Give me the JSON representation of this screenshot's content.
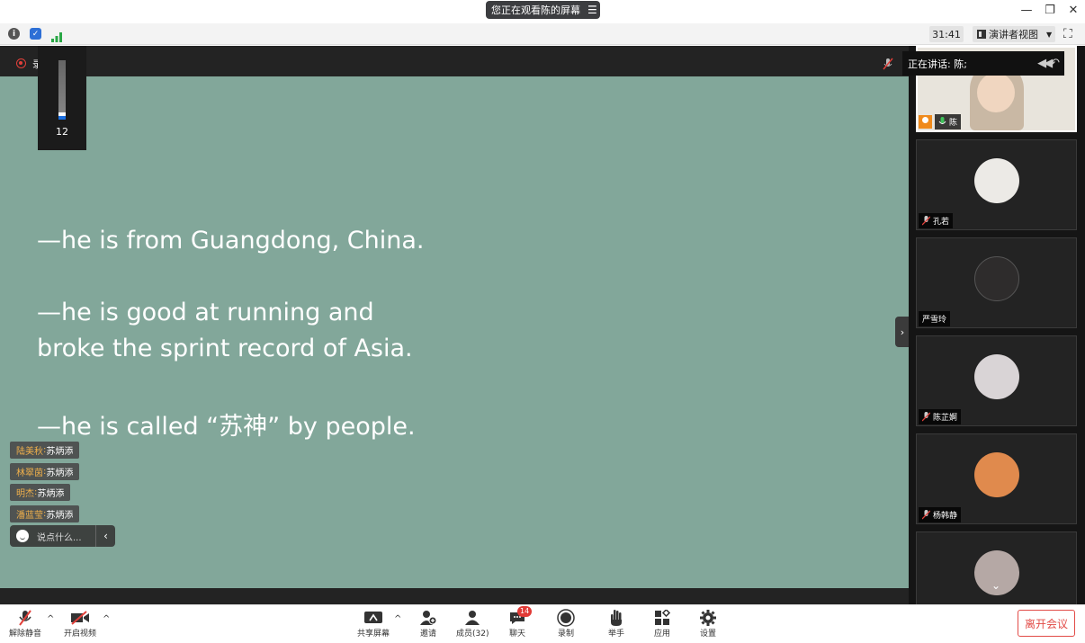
{
  "top_bar": {
    "share_notice": "您正在观看陈的屏幕"
  },
  "info_bar": {
    "timer": "31:41",
    "view_mode": "演讲者视图"
  },
  "stage": {
    "recording_label": "录",
    "mic_level_value": "12",
    "mic_level_fraction": 0.12,
    "slide_lines": [
      "—he is from Guangdong, China.",
      "—he is good at running and",
      "broke the sprint record of Asia.",
      "—he is called “苏神” by people."
    ]
  },
  "chat": {
    "messages": [
      {
        "name": "陆美秋",
        "text": "苏炳添"
      },
      {
        "name": "林翠茵",
        "text": "苏炳添"
      },
      {
        "name": "明杰",
        "text": "苏炳添"
      },
      {
        "name": "潘蓝莹",
        "text": "苏炳添"
      }
    ],
    "placeholder": "说点什么..."
  },
  "gallery": {
    "speaking_label": "正在讲话: 陈;",
    "tiles": [
      {
        "name": "陈",
        "muted": false,
        "avatar_color": "#e9dcc8"
      },
      {
        "name": "孔若",
        "muted": true,
        "avatar_color": "#eceae6"
      },
      {
        "name": "严雪玲",
        "muted": false,
        "avatar_color": "#2e2c2c"
      },
      {
        "name": "陈芷婀",
        "muted": true,
        "avatar_color": "#d9d4d6"
      },
      {
        "name": "杨韩静",
        "muted": true,
        "avatar_color": "#e08a4d"
      },
      {
        "name": "",
        "muted": false,
        "avatar_color": "#b5a8a5"
      }
    ]
  },
  "toolbar": {
    "unmute": "解除静音",
    "start_video": "开启视频",
    "share_screen": "共享屏幕",
    "invite": "邀请",
    "participants": "成员(32)",
    "chat": "聊天",
    "chat_badge": "14",
    "record": "录制",
    "raise_hand": "举手",
    "apps": "应用",
    "settings": "设置",
    "leave": "离开会议"
  },
  "colors": {
    "slide_bg": "#82a79a",
    "leave_red": "#e24b47",
    "chat_name": "#f0b04b"
  }
}
